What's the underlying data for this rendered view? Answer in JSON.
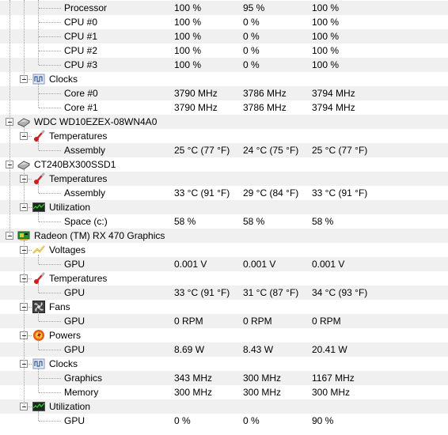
{
  "value_columns": 3,
  "rows": [
    {
      "level": 3,
      "label": "Processor",
      "values": [
        "100 %",
        "95 %",
        "100 %"
      ]
    },
    {
      "level": 3,
      "label": "CPU #0",
      "values": [
        "100 %",
        "0 %",
        "100 %"
      ]
    },
    {
      "level": 3,
      "label": "CPU #1",
      "values": [
        "100 %",
        "0 %",
        "100 %"
      ]
    },
    {
      "level": 3,
      "label": "CPU #2",
      "values": [
        "100 %",
        "0 %",
        "100 %"
      ]
    },
    {
      "level": 3,
      "label": "CPU #3",
      "values": [
        "100 %",
        "0 %",
        "100 %"
      ]
    },
    {
      "level": 2,
      "label": "Clocks",
      "icon": "clock-icon"
    },
    {
      "level": 3,
      "label": "Core #0",
      "values": [
        "3790 MHz",
        "3786 MHz",
        "3794 MHz"
      ]
    },
    {
      "level": 3,
      "label": "Core #1",
      "values": [
        "3790 MHz",
        "3786 MHz",
        "3794 MHz"
      ]
    },
    {
      "level": 1,
      "label": "WDC WD10EZEX-08WN4A0",
      "icon": "hard-drive-icon"
    },
    {
      "level": 2,
      "label": "Temperatures",
      "icon": "thermometer-icon"
    },
    {
      "level": 3,
      "label": "Assembly",
      "values": [
        "25 °C  (77 °F)",
        "24 °C  (75 °F)",
        "25 °C  (77 °F)"
      ]
    },
    {
      "level": 1,
      "label": "CT240BX300SSD1",
      "icon": "hard-drive-icon"
    },
    {
      "level": 2,
      "label": "Temperatures",
      "icon": "thermometer-icon"
    },
    {
      "level": 3,
      "label": "Assembly",
      "values": [
        "33 °C  (91 °F)",
        "29 °C  (84 °F)",
        "33 °C  (91 °F)"
      ]
    },
    {
      "level": 2,
      "label": "Utilization",
      "icon": "utilization-icon"
    },
    {
      "level": 3,
      "label": "Space (c:)",
      "values": [
        "58 %",
        "58 %",
        "58 %"
      ]
    },
    {
      "level": 1,
      "label": "Radeon (TM) RX 470 Graphics",
      "icon": "graphics-card-icon"
    },
    {
      "level": 2,
      "label": "Voltages",
      "icon": "voltage-icon"
    },
    {
      "level": 3,
      "label": "GPU",
      "values": [
        "0.001 V",
        "0.001 V",
        "0.001 V"
      ]
    },
    {
      "level": 2,
      "label": "Temperatures",
      "icon": "thermometer-icon"
    },
    {
      "level": 3,
      "label": "GPU",
      "values": [
        "33 °C  (91 °F)",
        "31 °C  (87 °F)",
        "34 °C  (93 °F)"
      ]
    },
    {
      "level": 2,
      "label": "Fans",
      "icon": "fan-icon"
    },
    {
      "level": 3,
      "label": "GPU",
      "values": [
        "0 RPM",
        "0 RPM",
        "0 RPM"
      ]
    },
    {
      "level": 2,
      "label": "Powers",
      "icon": "power-icon"
    },
    {
      "level": 3,
      "label": "GPU",
      "values": [
        "8.69 W",
        "8.43 W",
        "20.41 W"
      ]
    },
    {
      "level": 2,
      "label": "Clocks",
      "icon": "clock-icon"
    },
    {
      "level": 3,
      "label": "Graphics",
      "values": [
        "343 MHz",
        "300 MHz",
        "1167 MHz"
      ]
    },
    {
      "level": 3,
      "label": "Memory",
      "values": [
        "300 MHz",
        "300 MHz",
        "300 MHz"
      ]
    },
    {
      "level": 2,
      "label": "Utilization",
      "icon": "utilization-icon"
    },
    {
      "level": 3,
      "label": "GPU",
      "values": [
        "0 %",
        "0 %",
        "90 %"
      ]
    }
  ],
  "colors": {
    "alt_row": "#f0f0f0",
    "tree_lines": "#a0a0a0"
  }
}
